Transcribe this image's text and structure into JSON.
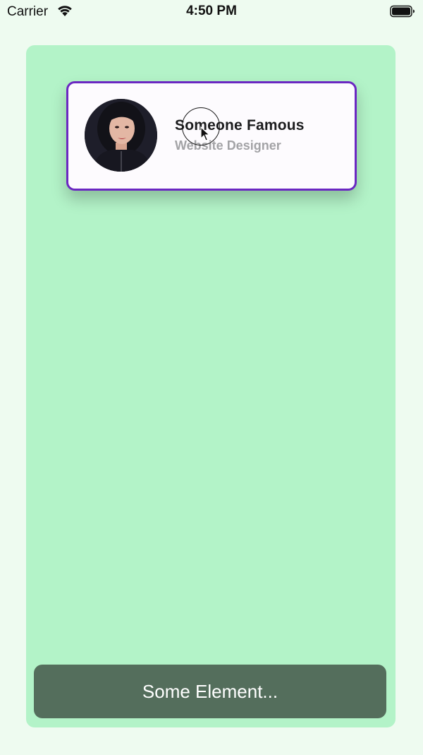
{
  "status_bar": {
    "carrier": "Carrier",
    "time": "4:50 PM",
    "wifi_icon": "wifi-icon",
    "battery_icon": "battery-icon"
  },
  "profile": {
    "name": "Someone Famous",
    "role": "Website Designer",
    "avatar_icon": "avatar-photo"
  },
  "bottom_element": {
    "label": "Some Element..."
  },
  "colors": {
    "background": "#eefbf0",
    "container": "#b3f3c8",
    "card_border": "#6b27c2",
    "card_background": "#fdfbfe",
    "bottom_element": "#546e5c"
  }
}
